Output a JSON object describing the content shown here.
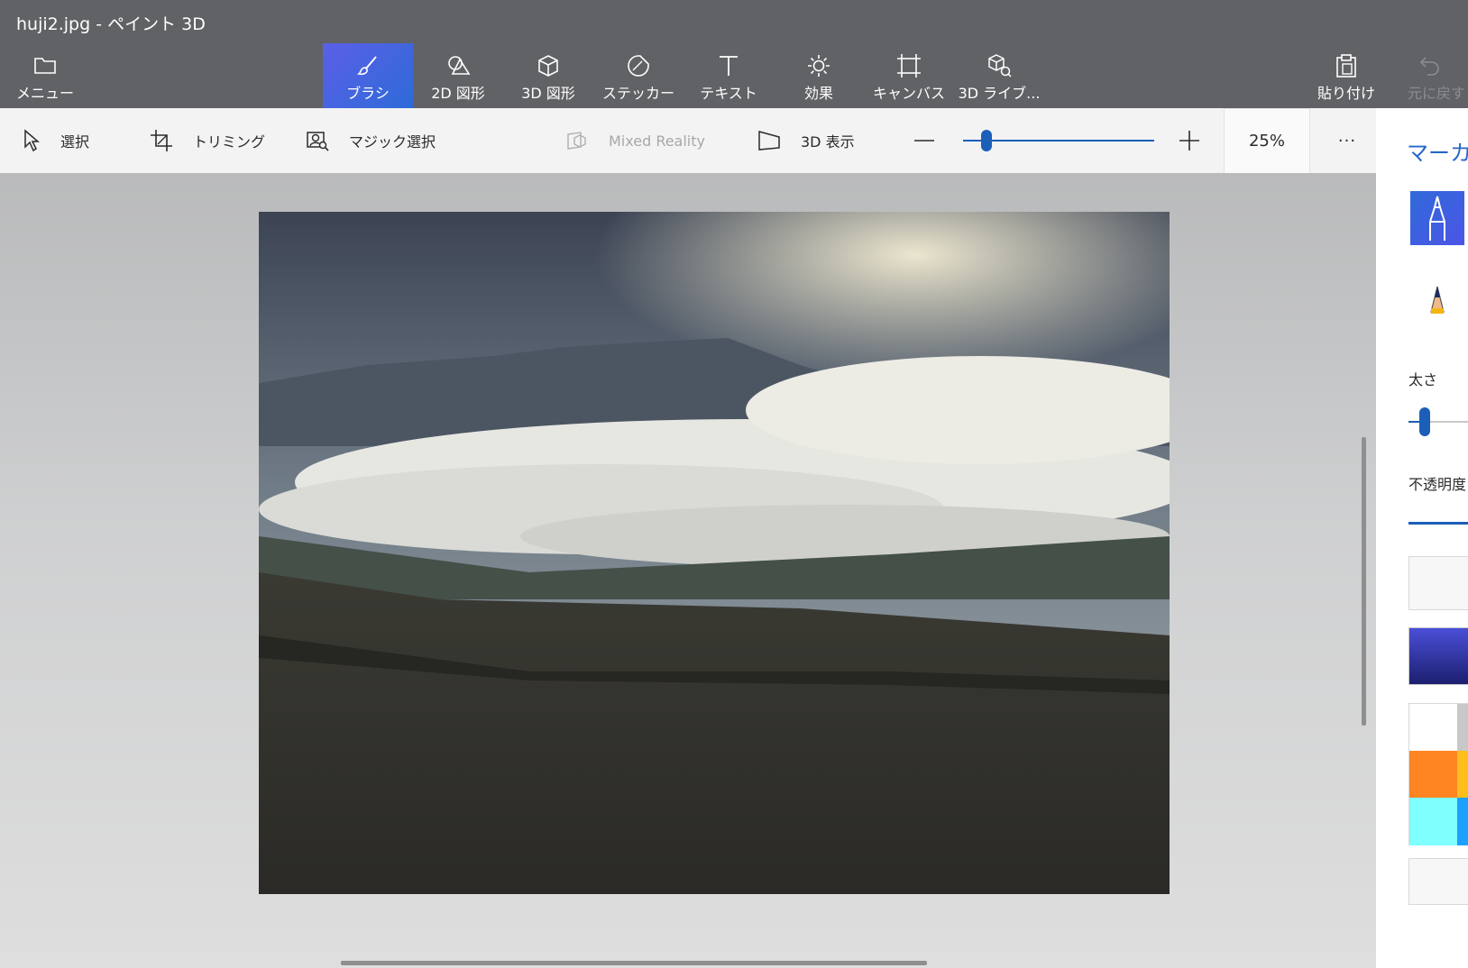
{
  "window": {
    "title": "huji2.jpg - ペイント 3D"
  },
  "toolbar": {
    "menu_label": "メニュー",
    "brush_label": "ブラシ",
    "shapes2d_label": "2D 図形",
    "shapes3d_label": "3D 図形",
    "stickers_label": "ステッカー",
    "text_label": "テキスト",
    "effects_label": "効果",
    "canvas_label": "キャンバス",
    "library3d_label": "3D ライブ...",
    "paste_label": "貼り付け",
    "undo_label": "元に戻す"
  },
  "subtoolbar": {
    "select_label": "選択",
    "crop_label": "トリミング",
    "magic_select_label": "マジック選択",
    "mixed_reality_label": "Mixed Reality",
    "view3d_label": "3D 表示",
    "zoom_value": "25%",
    "zoom_slider_fraction": 0.1,
    "more_label": "···"
  },
  "side_panel": {
    "title": "マーカー",
    "thickness_label": "太さ",
    "thickness_fraction": 0.1,
    "opacity_label": "不透明度",
    "selected_color": "#4a4fd8",
    "palette": [
      "#ffffff",
      "#c8c8c8",
      "#ff8422",
      "#ffbe1c",
      "#80ffff",
      "#1ea0ff"
    ]
  },
  "icons": [
    "folder-icon",
    "brush-icon",
    "shapes-2d-icon",
    "cube-icon",
    "sticker-icon",
    "text-t-icon",
    "sun-icon",
    "canvas-crop-icon",
    "library-3d-icon",
    "paste-icon",
    "undo-icon",
    "cursor-icon",
    "crop-icon",
    "magic-select-icon",
    "mixed-reality-icon",
    "view-3d-icon",
    "marker-icon",
    "pencil-icon"
  ],
  "colors": {
    "accent": "#2866c8",
    "titlebar": "#616266",
    "active_tool": "#4a5fe0"
  }
}
